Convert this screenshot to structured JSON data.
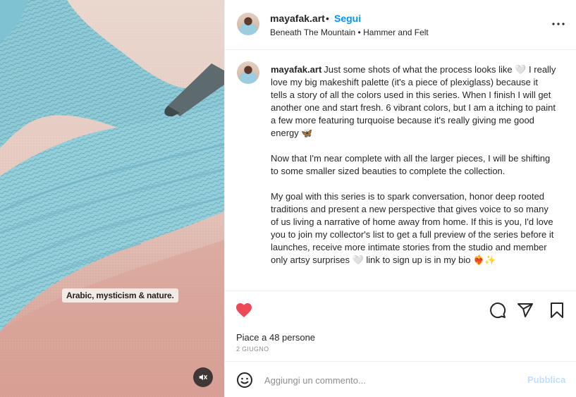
{
  "media": {
    "overlay_text": "Arabic, mysticism & nature.",
    "mute_icon": "speaker-muted-icon"
  },
  "header": {
    "username": "mayafak.art",
    "separator": "•",
    "follow_label": "Segui",
    "location": "Beneath The Mountain • Hammer and Felt",
    "more_icon": "more-options-icon"
  },
  "caption": {
    "username": "mayafak.art",
    "paragraphs": [
      "Just some shots of what the process looks like 🤍 I really love my big makeshift palette (it's a piece of plexiglass) because it tells a story of all the colors used in this series. When I finish I will get another one and start fresh. 6 vibrant colors, but I am a itching to paint a few more featuring turquoise because it's really giving me good energy 🦋",
      "Now that I'm near complete with all the larger pieces, I will be shifting to some smaller sized beauties to complete the collection.",
      "My goal with this series is to spark conversation, honor deep rooted traditions and present a new perspective that gives voice to so many of us living a narrative of home away from home. If this is you, I'd love you to join my collector's list to get a full preview of the series before it launches, receive more intimate stories from the studio and member only artsy surprises 🤍 link to sign up is in my bio ❤️‍🔥✨"
    ]
  },
  "actions": {
    "likes_text": "Piace a 48 persone",
    "date": "2 GIUGNO"
  },
  "add_comment": {
    "placeholder": "Aggiungi un commento...",
    "publish_label": "Pubblica"
  },
  "colors": {
    "like": "#ed4956",
    "link": "#0095f6",
    "publish_disabled": "#c0dffd",
    "paint_turquoise": "#8fcbd8"
  }
}
